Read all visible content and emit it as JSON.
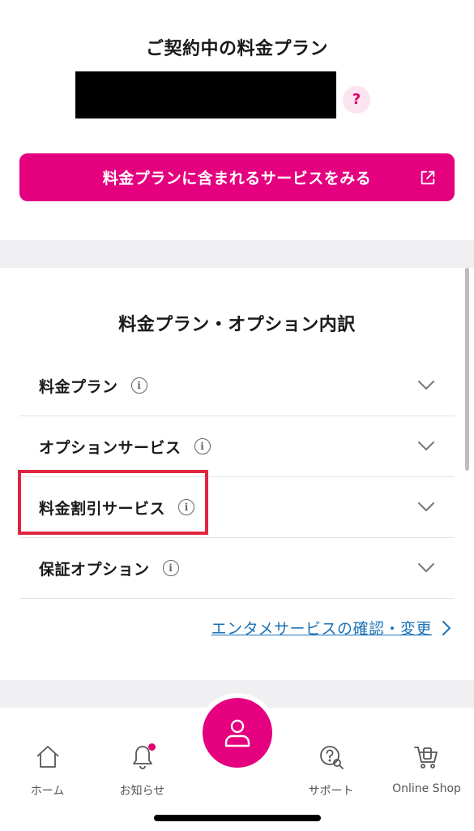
{
  "plan": {
    "title": "ご契約中の料金プラン",
    "help_label": "?",
    "services_button_label": "料金プランに含まれるサービスをみる"
  },
  "breakdown": {
    "title": "料金プラン・オプション内訳",
    "rows": [
      {
        "label": "料金プラン"
      },
      {
        "label": "オプションサービス"
      },
      {
        "label": "料金割引サービス"
      },
      {
        "label": "保証オプション"
      }
    ],
    "info_glyph": "i",
    "enta_link_label": "エンタメサービスの確認・変更"
  },
  "tabbar": {
    "home": "ホーム",
    "news": "お知らせ",
    "support": "サポート",
    "shop": "Online Shop"
  },
  "colors": {
    "brand": "#e4007f",
    "link": "#1b72b8",
    "highlight": "#e0263f"
  }
}
